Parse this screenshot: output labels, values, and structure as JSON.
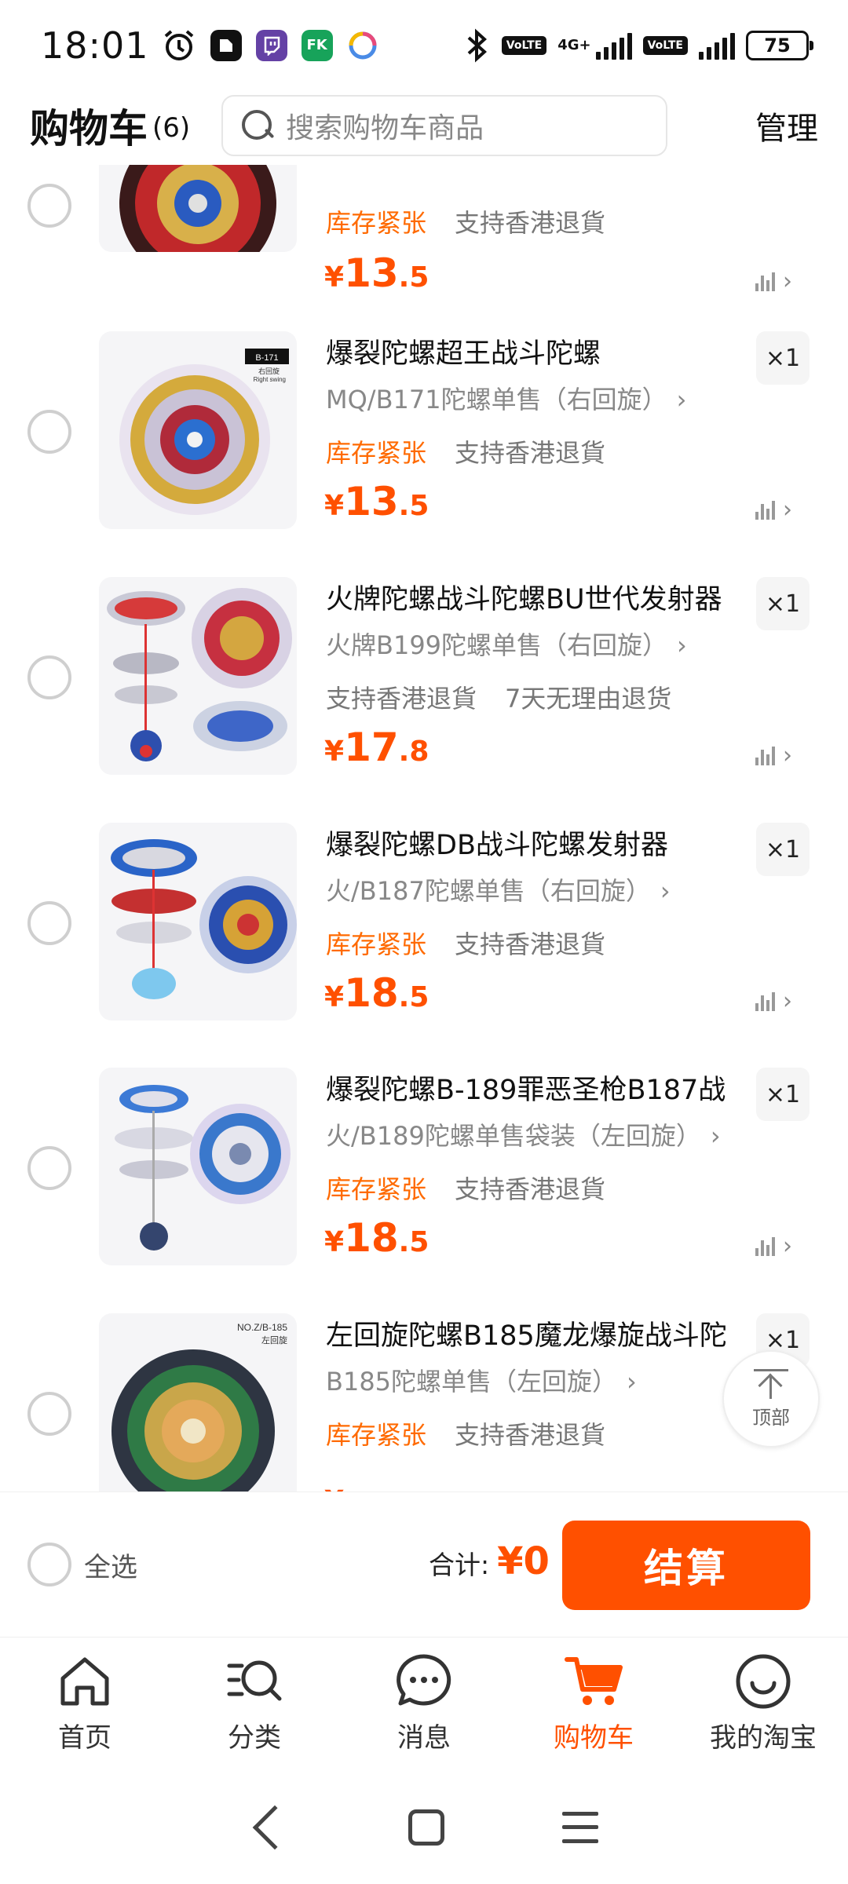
{
  "status_bar": {
    "time": "18:01",
    "volte_1": "VoLTE",
    "network": "4G+",
    "volte_2": "VoLTE",
    "battery": "75",
    "app_icons": [
      "alarm-icon",
      "notes-app-icon",
      "twitch-icon",
      "fk-app-icon",
      "ring-app-icon"
    ]
  },
  "header": {
    "title": "购物车",
    "count": "(6)",
    "search_placeholder": "搜索购物车商品",
    "manage": "管理"
  },
  "items": [
    {
      "title": "",
      "variant": "",
      "tags": [
        "库存紧张",
        "支持香港退貨"
      ],
      "tag_types": [
        "orange",
        "gray"
      ],
      "price_yen": "¥",
      "price_int": "13",
      "price_dec": ".5",
      "qty": ""
    },
    {
      "title": "爆裂陀螺超王战斗陀螺",
      "variant": "MQ/B171陀螺单售（右回旋）",
      "tags": [
        "库存紧张",
        "支持香港退貨"
      ],
      "tag_types": [
        "orange",
        "gray"
      ],
      "price_yen": "¥",
      "price_int": "13",
      "price_dec": ".5",
      "qty": "×1",
      "thumb_label_1": "B-171",
      "thumb_label_2": "右回旋",
      "thumb_label_3": "Right swing"
    },
    {
      "title": "火牌陀螺战斗陀螺BU世代发射器",
      "variant": "火牌B199陀螺单售（右回旋）",
      "tags": [
        "支持香港退貨",
        "7天无理由退货"
      ],
      "tag_types": [
        "gray",
        "gray"
      ],
      "price_yen": "¥",
      "price_int": "17",
      "price_dec": ".8",
      "qty": "×1"
    },
    {
      "title": "爆裂陀螺DB战斗陀螺发射器",
      "variant": "火/B187陀螺单售（右回旋）",
      "tags": [
        "库存紧张",
        "支持香港退貨"
      ],
      "tag_types": [
        "orange",
        "gray"
      ],
      "price_yen": "¥",
      "price_int": "18",
      "price_dec": ".5",
      "qty": "×1"
    },
    {
      "title": "爆裂陀螺B-189罪恶圣枪B187战",
      "variant": "火/B189陀螺单售袋装（左回旋）",
      "tags": [
        "库存紧张",
        "支持香港退貨"
      ],
      "tag_types": [
        "orange",
        "gray"
      ],
      "price_yen": "¥",
      "price_int": "18",
      "price_dec": ".5",
      "qty": "×1"
    },
    {
      "title": "左回旋陀螺B185魔龙爆旋战斗陀",
      "variant": "B185陀螺单售（左回旋）",
      "tags": [
        "库存紧张",
        "支持香港退貨"
      ],
      "tag_types": [
        "orange",
        "gray"
      ],
      "price_yen": "¥",
      "price_int": "",
      "price_dec": "",
      "qty": "×1",
      "thumb_label_1": "NO.Z/B-185",
      "thumb_label_2": "左回旋"
    }
  ],
  "back_to_top": "顶部",
  "checkout": {
    "select_all": "全选",
    "total_label": "合计:",
    "total_amount": "¥0",
    "button": "结算"
  },
  "tabs": [
    {
      "label": "首页",
      "icon": "home-icon",
      "active": false
    },
    {
      "label": "分类",
      "icon": "category-search-icon",
      "active": false
    },
    {
      "label": "消息",
      "icon": "message-icon",
      "active": false
    },
    {
      "label": "购物车",
      "icon": "cart-icon",
      "active": true
    },
    {
      "label": "我的淘宝",
      "icon": "profile-smile-icon",
      "active": false
    }
  ],
  "colors": {
    "accent": "#ff5000",
    "tag_orange": "#ff6a00",
    "muted": "#888888"
  }
}
